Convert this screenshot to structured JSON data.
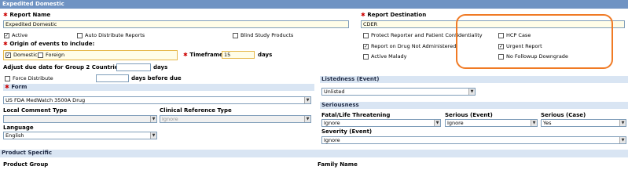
{
  "window": {
    "title": "Expedited Domestic"
  },
  "report_name": {
    "label": "Report Name",
    "value": "Expedited Domestic"
  },
  "report_destination": {
    "label": "Report Destination",
    "value": "CDER"
  },
  "checkboxes_row1": {
    "active": {
      "label": "Active",
      "checked": true
    },
    "auto_distribute": {
      "label": "Auto Distribute Reports",
      "checked": false
    },
    "blind_study": {
      "label": "Blind Study Products",
      "checked": false
    },
    "protect_reporter": {
      "label": "Protect Reporter and Patient Confidentiality",
      "checked": false
    },
    "hcp_case": {
      "label": "HCP Case",
      "checked": false
    }
  },
  "origin": {
    "label": "Origin of events to include:",
    "domestic": {
      "label": "Domestic",
      "checked": true
    },
    "foreign": {
      "label": "Foreign",
      "checked": false
    }
  },
  "report_drug_not_admin": {
    "label": "Report on Drug Not Administered",
    "checked": true
  },
  "urgent_report": {
    "label": "Urgent Report",
    "checked": true
  },
  "active_malady": {
    "label": "Active Malady",
    "checked": false
  },
  "no_followup": {
    "label": "No Followup Downgrade",
    "checked": false
  },
  "timeframe": {
    "label": "Timeframe",
    "value": "15",
    "unit": "days"
  },
  "adjust_due": {
    "label": "Adjust due date for Group 2 Countries by",
    "value": "",
    "unit": "days"
  },
  "force_distribute": {
    "label": "Force Distribute",
    "checked": false,
    "value": "",
    "suffix": "days before due"
  },
  "form": {
    "label": "Form",
    "value": "US FDA MedWatch 3500A Drug"
  },
  "local_comment": {
    "label": "Local Comment Type",
    "value": ""
  },
  "clinical_ref": {
    "label": "Clinical Reference Type",
    "value": "Ignore"
  },
  "language": {
    "label": "Language",
    "value": "English"
  },
  "listedness": {
    "label": "Listedness (Event)",
    "value": "Unlisted"
  },
  "seriousness": {
    "title": "Seriousness",
    "fatal": {
      "label": "Fatal/Life Threatening",
      "value": "Ignore"
    },
    "serious_event": {
      "label": "Serious (Event)",
      "value": "Ignore"
    },
    "serious_case": {
      "label": "Serious (Case)",
      "value": "Yes"
    },
    "severity": {
      "label": "Severity (Event)",
      "value": "Ignore"
    }
  },
  "product_specific": {
    "title": "Product Specific",
    "product_group": "Product Group",
    "family_name": "Family Name"
  }
}
